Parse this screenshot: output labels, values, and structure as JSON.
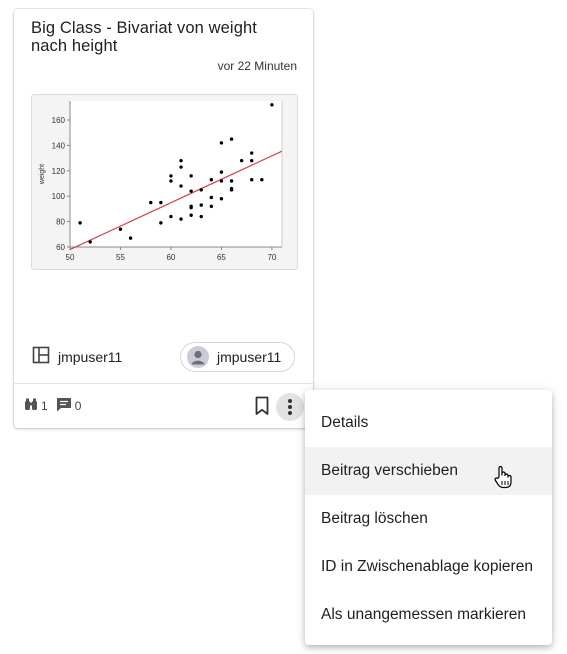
{
  "card": {
    "title": "Big Class - Bivariat von weight nach height",
    "time": "vor 22 Minuten",
    "owner_label": "jmpuser11",
    "chip_label": "jmpuser11",
    "views": "1",
    "comments": "0"
  },
  "icons": {
    "owner": "layout-panel-icon",
    "avatar": "user-avatar-icon",
    "views": "binoculars-icon",
    "comments": "comment-icon",
    "bookmark": "bookmark-icon",
    "more": "more-vertical-icon",
    "cursor": "hand-pointer-cursor"
  },
  "menu": {
    "items": [
      "Details",
      "Beitrag verschieben",
      "Beitrag löschen",
      "ID in Zwischenablage kopieren",
      "Als unangemessen markieren"
    ],
    "hovered_index": 1
  },
  "colors": {
    "fit_line": "#d9404a",
    "points": "#000000",
    "hover": "#f2f2f2"
  },
  "chart_data": {
    "type": "scatter",
    "xlabel": "",
    "ylabel": "weight",
    "xlim": [
      50,
      71
    ],
    "ylim": [
      60,
      175
    ],
    "xticks": [
      "50",
      "55",
      "60",
      "65",
      "70"
    ],
    "yticks": [
      "60",
      "80",
      "100",
      "120",
      "140",
      "160"
    ],
    "points": [
      [
        51,
        79
      ],
      [
        52,
        64
      ],
      [
        55,
        74
      ],
      [
        56,
        67
      ],
      [
        58,
        95
      ],
      [
        59,
        95
      ],
      [
        59,
        79
      ],
      [
        60,
        84
      ],
      [
        60,
        112
      ],
      [
        60,
        116
      ],
      [
        61,
        82
      ],
      [
        61,
        108
      ],
      [
        61,
        123
      ],
      [
        61,
        128
      ],
      [
        62,
        85
      ],
      [
        62,
        91
      ],
      [
        62,
        92
      ],
      [
        62,
        104
      ],
      [
        62,
        116
      ],
      [
        63,
        84
      ],
      [
        63,
        93
      ],
      [
        63,
        105
      ],
      [
        64,
        92
      ],
      [
        64,
        99
      ],
      [
        64,
        113
      ],
      [
        65,
        98
      ],
      [
        65,
        112
      ],
      [
        65,
        142
      ],
      [
        65,
        119
      ],
      [
        66,
        105
      ],
      [
        66,
        106
      ],
      [
        66,
        145
      ],
      [
        66,
        112
      ],
      [
        67,
        128
      ],
      [
        68,
        113
      ],
      [
        68,
        128
      ],
      [
        68,
        134
      ],
      [
        69,
        113
      ],
      [
        70,
        172
      ]
    ],
    "fit": {
      "x": [
        50,
        71
      ],
      "y": [
        58,
        135.5
      ]
    }
  }
}
